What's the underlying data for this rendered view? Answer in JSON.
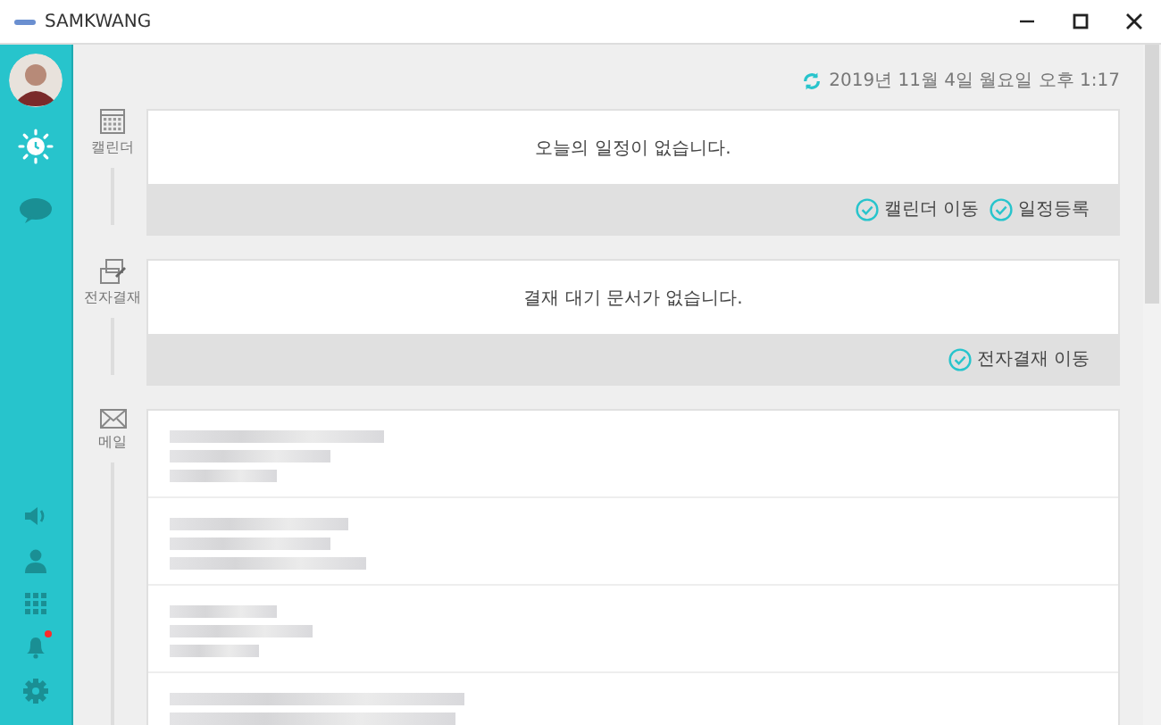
{
  "window": {
    "title": "SAMKWANG"
  },
  "sidebar": {
    "top_items": [
      {
        "kind": "avatar",
        "selected": false
      },
      {
        "kind": "clock",
        "selected": true
      },
      {
        "kind": "chat",
        "selected": false
      }
    ],
    "bottom_items": [
      {
        "kind": "speaker",
        "badge": false
      },
      {
        "kind": "person",
        "badge": false
      },
      {
        "kind": "grid",
        "badge": false
      },
      {
        "kind": "bell",
        "badge": true
      },
      {
        "kind": "gear",
        "badge": false
      }
    ]
  },
  "timestamp": "2019년 11월 4일 월요일 오후 1:17",
  "sections": [
    {
      "kind": "calendar",
      "label": "캘린더",
      "message": "오늘의 일정이 없습니다.",
      "actions": [
        "캘린더 이동",
        "일정등록"
      ]
    },
    {
      "kind": "approval",
      "label": "전자결재",
      "message": "결재 대기 문서가 없습니다.",
      "actions": [
        "전자결재 이동"
      ]
    },
    {
      "kind": "mail",
      "label": "메일"
    }
  ]
}
